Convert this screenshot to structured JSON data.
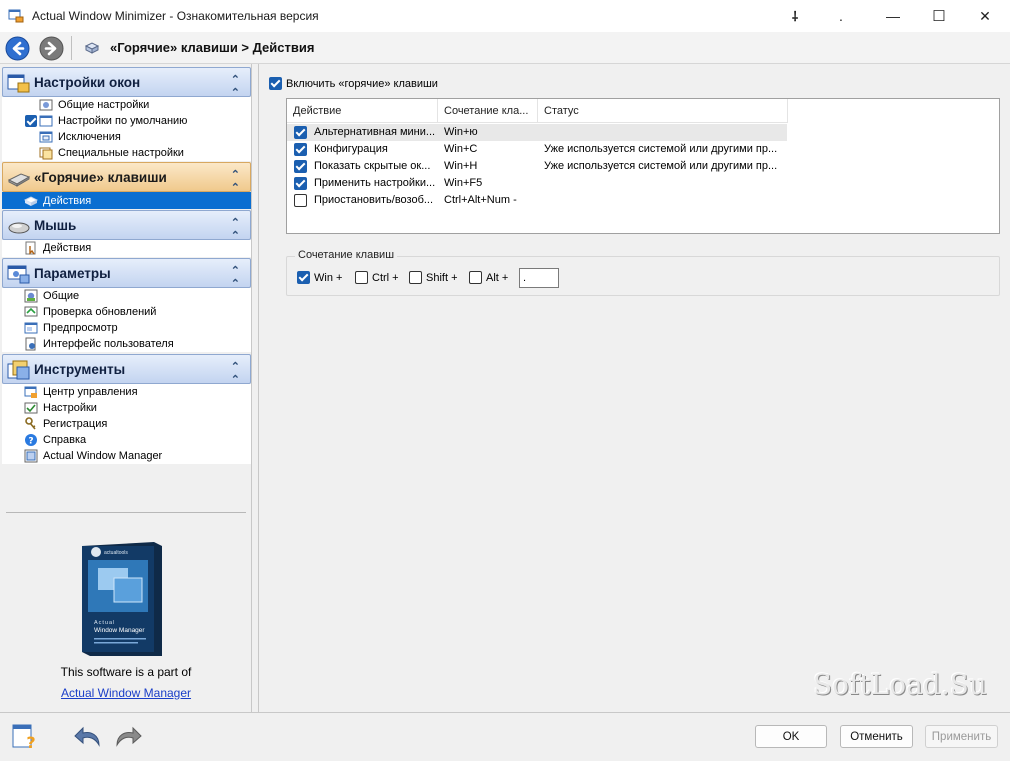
{
  "window": {
    "title": "Actual Window Minimizer - Ознакомительная версия",
    "controls": {
      "pin": "⸸",
      "dot": ".",
      "minimize": "—",
      "maximize": "☐",
      "close": "✕"
    }
  },
  "nav": {
    "breadcrumb": "«Горячие» клавиши > Действия"
  },
  "sidebar": {
    "groups": [
      {
        "label": "Настройки окон",
        "items": [
          "Общие настройки",
          "Настройки по умолчанию",
          "Исключения",
          "Специальные настройки"
        ]
      },
      {
        "label": "«Горячие» клавиши",
        "items": [
          "Действия"
        ]
      },
      {
        "label": "Мышь",
        "items": [
          "Действия"
        ]
      },
      {
        "label": "Параметры",
        "items": [
          "Общие",
          "Проверка обновлений",
          "Предпросмотр",
          "Интерфейс пользователя"
        ]
      },
      {
        "label": "Инструменты",
        "items": [
          "Центр управления",
          "Настройки",
          "Регистрация",
          "Справка",
          "Actual Window Manager"
        ]
      }
    ],
    "promo": {
      "box_brand": "actualtools",
      "box_line1": "Actual",
      "box_line2": "Window Manager",
      "text": "This software is a part of",
      "link": "Actual Window Manager"
    }
  },
  "main": {
    "enable_label": "Включить «горячие» клавиши",
    "columns": [
      "Действие",
      "Сочетание кла...",
      "Статус"
    ],
    "rows": [
      {
        "checked": true,
        "action": "Альтернативная мини...",
        "keys": "Win+ю",
        "status": ""
      },
      {
        "checked": true,
        "action": "Конфигурация",
        "keys": "Win+C",
        "status": "Уже используется системой или другими пр..."
      },
      {
        "checked": true,
        "action": "Показать скрытые ок...",
        "keys": "Win+H",
        "status": "Уже используется системой или другими пр..."
      },
      {
        "checked": true,
        "action": "Применить настройки...",
        "keys": "Win+F5",
        "status": ""
      },
      {
        "checked": false,
        "action": "Приостановить/возоб...",
        "keys": "Ctrl+Alt+Num -",
        "status": ""
      }
    ],
    "combo": {
      "legend": "Сочетание клавиш",
      "win": "Win +",
      "ctrl": "Ctrl +",
      "shift": "Shift +",
      "alt": "Alt +",
      "key_value": "."
    }
  },
  "watermark": "SoftLoad.Su",
  "buttons": {
    "ok": "OK",
    "cancel": "Отменить",
    "apply": "Применить"
  },
  "colors": {
    "selection": "#0a6ed1",
    "header_blue": "#c3d4f0",
    "header_active": "#f0c98c",
    "check": "#1b5fb0"
  }
}
